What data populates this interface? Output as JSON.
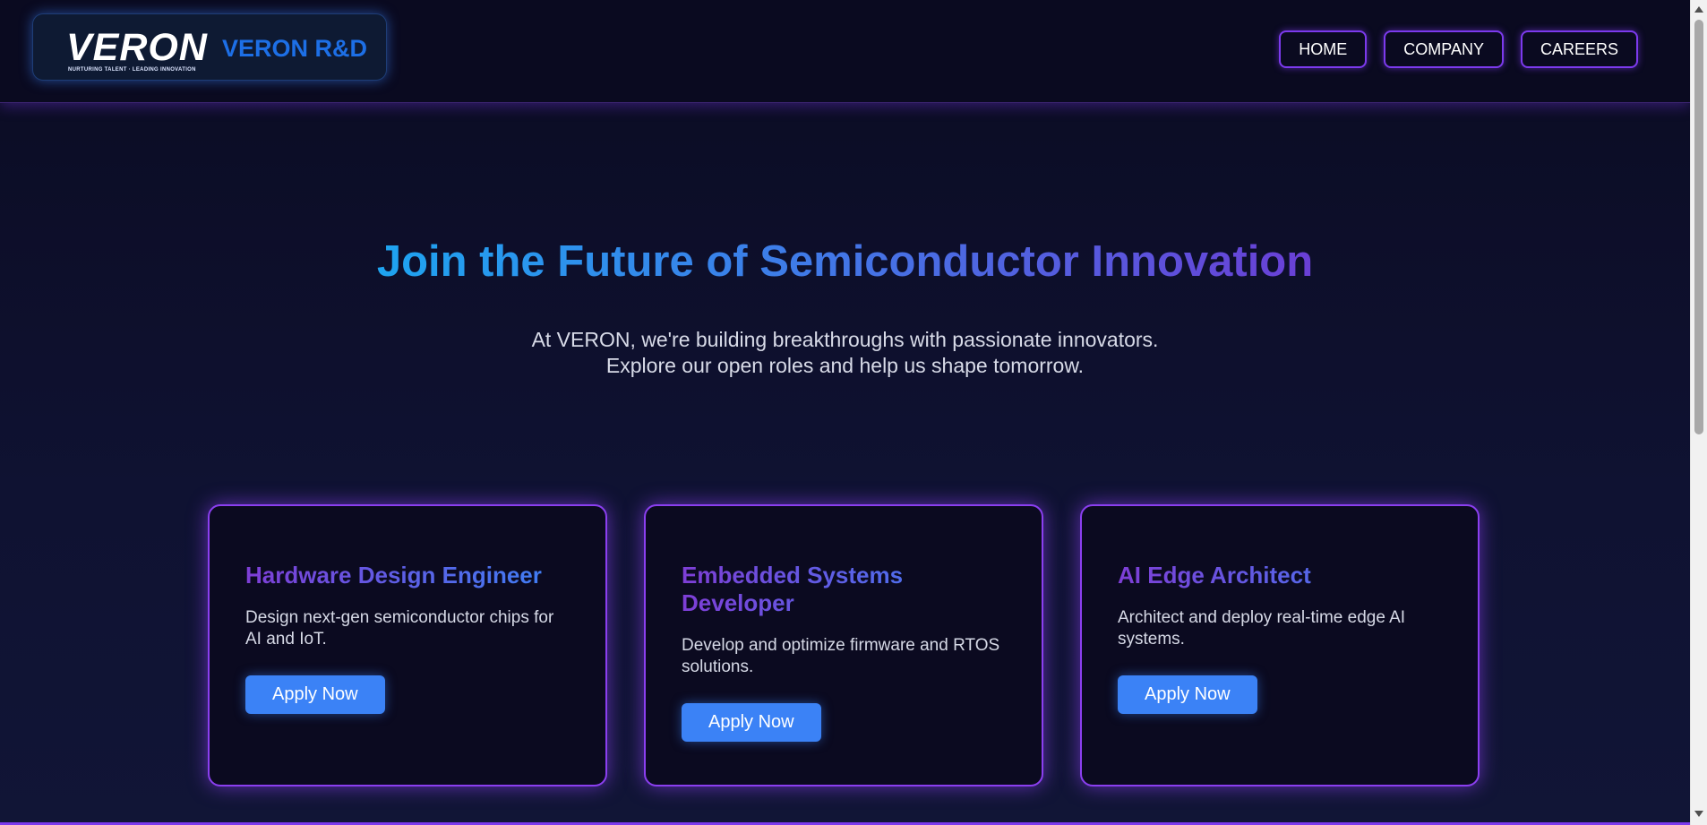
{
  "header": {
    "logo_text": "VERON",
    "logo_tagline": "NURTURING TALENT · LEADING INNOVATION",
    "brand_name": "VERON R&D",
    "nav": [
      {
        "label": "HOME"
      },
      {
        "label": "COMPANY"
      },
      {
        "label": "CAREERS"
      }
    ]
  },
  "hero": {
    "title": "Join the Future of Semiconductor Innovation",
    "subtitle_line1": "At VERON, we're building breakthroughs with passionate innovators.",
    "subtitle_line2": "Explore our open roles and help us shape tomorrow."
  },
  "jobs": [
    {
      "title": "Hardware Design Engineer",
      "description": "Design next-gen semiconductor chips for AI and IoT.",
      "button": "Apply Now"
    },
    {
      "title": "Embedded Systems Developer",
      "description": "Develop and optimize firmware and RTOS solutions.",
      "button": "Apply Now"
    },
    {
      "title": "AI Edge Architect",
      "description": "Architect and deploy real-time edge AI systems.",
      "button": "Apply Now"
    }
  ],
  "colors": {
    "accent_purple": "#7c3aed",
    "accent_blue": "#3b82f6",
    "background": "#0b0b22"
  }
}
